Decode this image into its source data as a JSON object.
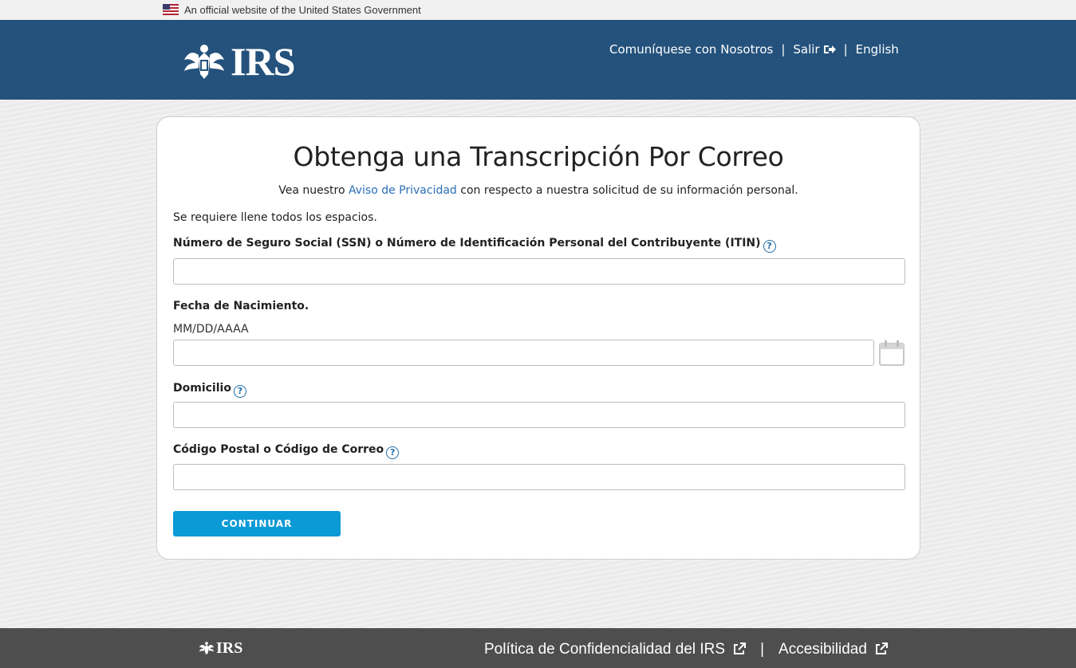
{
  "gov_banner": {
    "text": "An official website of the United States Government"
  },
  "header": {
    "logo_text": "IRS",
    "nav": [
      {
        "label": "Comuníquese con Nosotros"
      },
      {
        "label": "Salir"
      },
      {
        "label": "English"
      }
    ]
  },
  "card": {
    "title": "Obtenga una Transcripción Por Correo",
    "privacy_prefix": "Vea nuestro ",
    "privacy_link": "Aviso de Privacidad",
    "privacy_suffix": " con respecto a nuestra solicitud de su información personal.",
    "required_note": "Se requiere llene todos los espacios.",
    "fields": [
      {
        "label": "Número de Seguro Social (SSN) o Número de Identificación Personal del Contribuyente (ITIN)",
        "value": "",
        "has_help": true
      },
      {
        "label": "Fecha de Nacimiento.",
        "hint": "MM/DD/AAAA",
        "value": "",
        "has_help": false
      },
      {
        "label": "Domicilio",
        "value": "",
        "has_help": true
      },
      {
        "label": "Código Postal o Código de Correo",
        "value": "",
        "has_help": true
      }
    ],
    "help_glyph": "?",
    "continue_label": "CONTINUAR"
  },
  "footer": {
    "logo_text": "IRS",
    "links": [
      {
        "label": "Política de Confidencialidad del IRS"
      },
      {
        "label": "Accesibilidad"
      }
    ]
  },
  "colors": {
    "header_bg": "#24527c",
    "button_bg": "#0a9ad6",
    "link": "#2a6fb6",
    "footer_bg": "#4e4e4e"
  }
}
